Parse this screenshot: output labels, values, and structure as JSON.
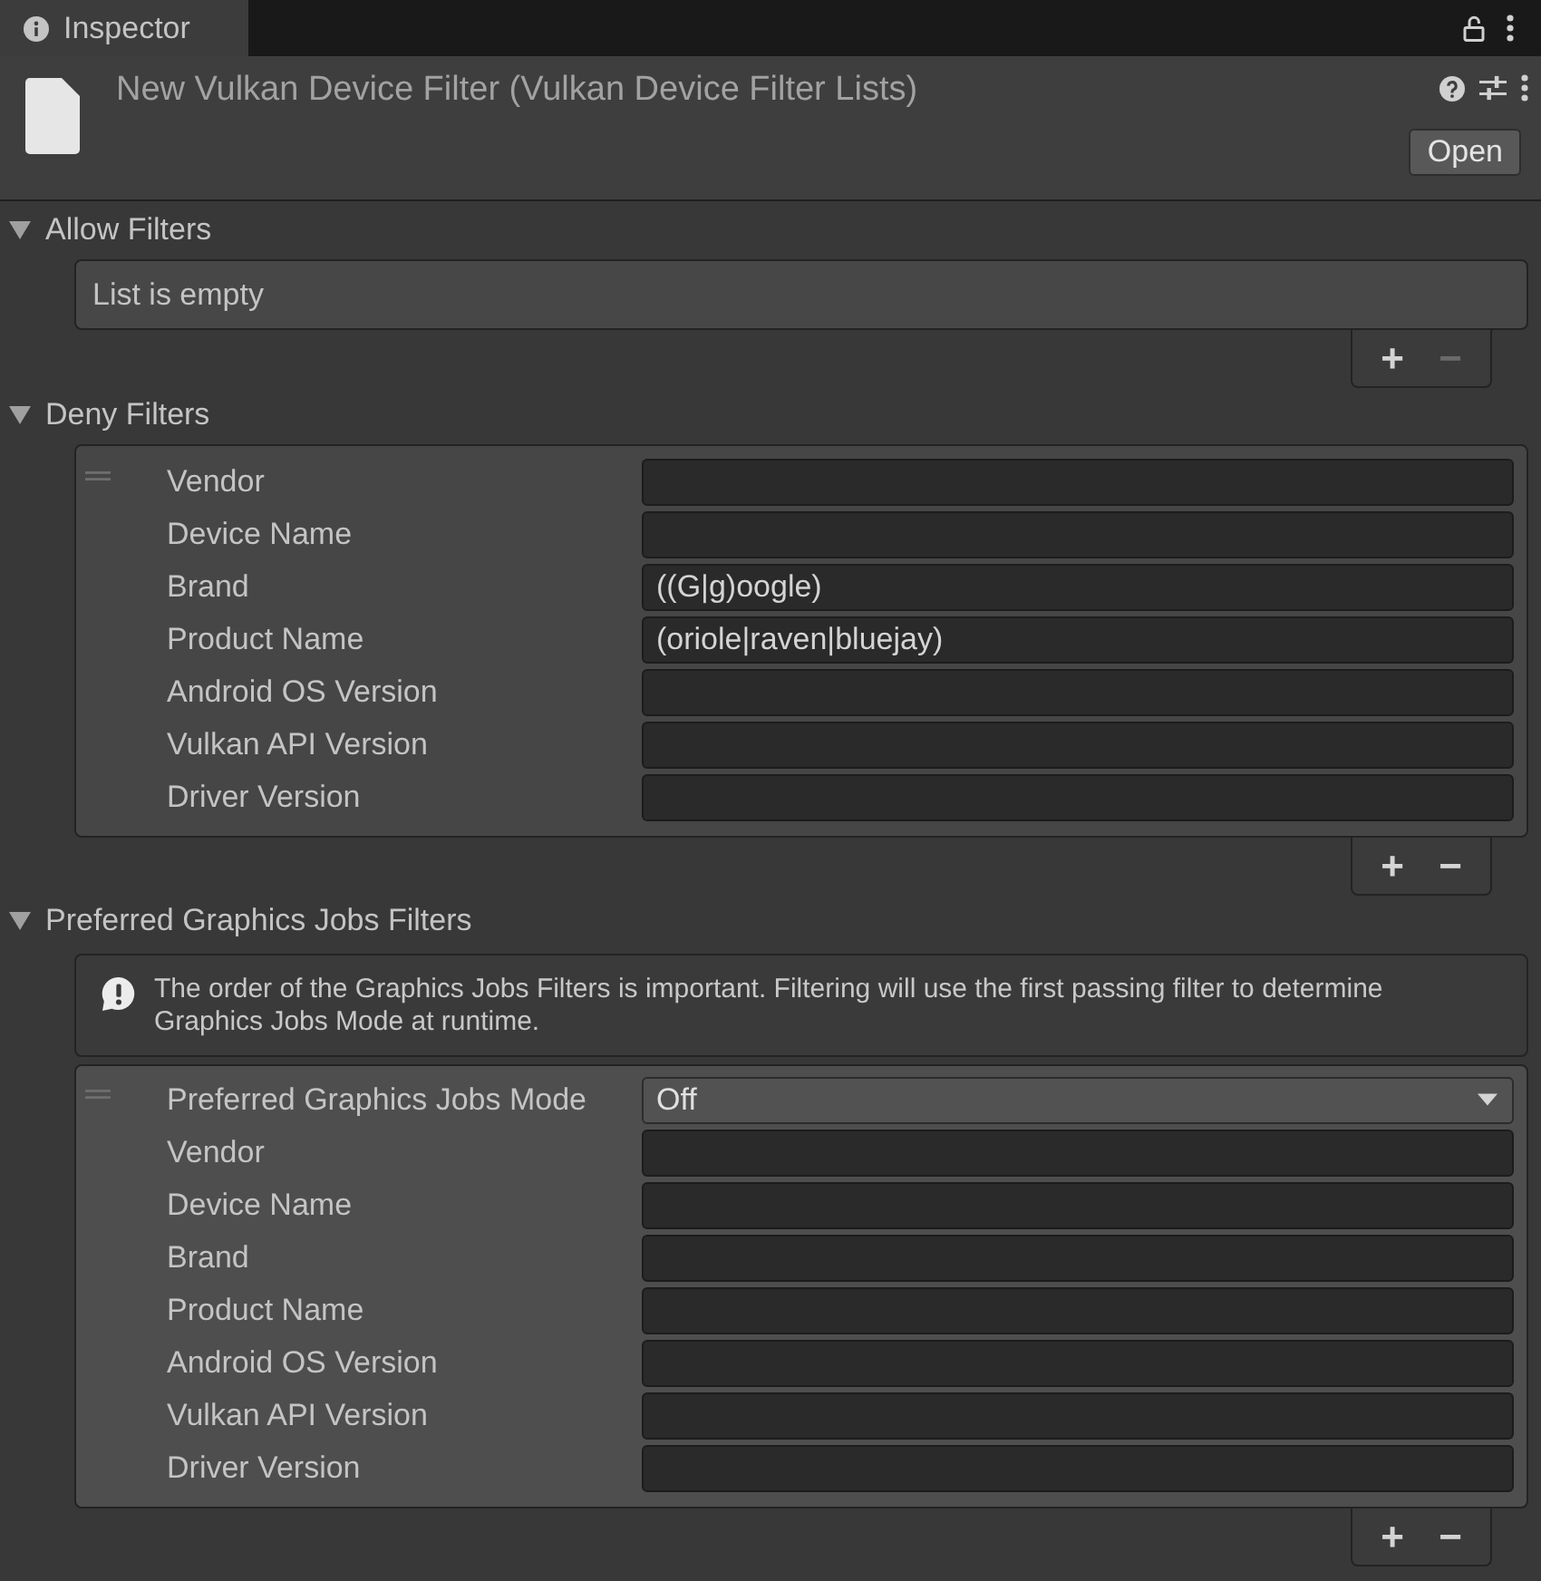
{
  "window": {
    "tab": {
      "label": "Inspector",
      "selected": true
    }
  },
  "header": {
    "title": "New Vulkan Device Filter (Vulkan Device Filter Lists)",
    "open_button": "Open"
  },
  "sections": [
    {
      "title": "Allow Filters",
      "expanded": true,
      "empty_text": "List is empty",
      "add_label": "+",
      "remove_label": "−",
      "remove_disabled": true
    },
    {
      "title": "Deny Filters",
      "expanded": true,
      "elements": [
        {
          "selected": false,
          "fields": [
            {
              "kind": "text",
              "label": "Vendor"
            },
            {
              "kind": "text",
              "label": "Device Name"
            },
            {
              "kind": "text",
              "label": "Brand",
              "value": "((G|g)oogle)"
            },
            {
              "kind": "text",
              "label": "Product Name",
              "value": "(oriole|raven|bluejay)"
            },
            {
              "kind": "text",
              "label": "Android OS Version"
            },
            {
              "kind": "text",
              "label": "Vulkan API Version"
            },
            {
              "kind": "text",
              "label": "Driver Version"
            }
          ]
        }
      ],
      "add_label": "+",
      "remove_label": "−",
      "remove_disabled": false
    },
    {
      "title": "Preferred Graphics Jobs Filters",
      "expanded": true,
      "help_text": "The order of the Graphics Jobs Filters is important. Filtering will use the first passing filter to determine Graphics Jobs Mode at runtime.",
      "elements": [
        {
          "selected": true,
          "fields": [
            {
              "kind": "dropdown",
              "label": "Preferred Graphics Jobs Mode",
              "value": "Off"
            },
            {
              "kind": "text",
              "label": "Vendor"
            },
            {
              "kind": "text",
              "label": "Device Name"
            },
            {
              "kind": "text",
              "label": "Brand"
            },
            {
              "kind": "text",
              "label": "Product Name"
            },
            {
              "kind": "text",
              "label": "Android OS Version"
            },
            {
              "kind": "text",
              "label": "Vulkan API Version"
            },
            {
              "kind": "text",
              "label": "Driver Version"
            }
          ]
        }
      ],
      "add_label": "+",
      "remove_label": "−",
      "remove_disabled": false
    }
  ]
}
